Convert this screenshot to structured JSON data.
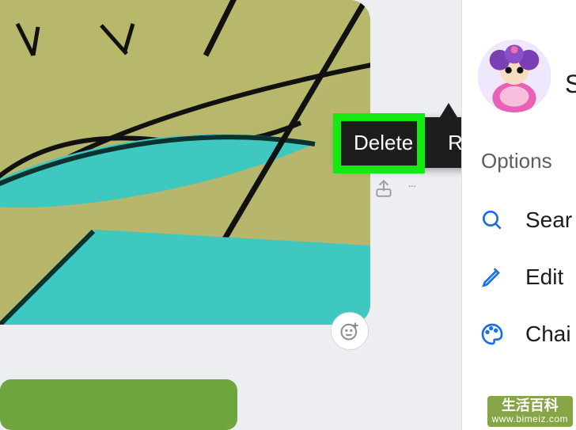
{
  "tooltip": {
    "delete": "Delete",
    "react": "React"
  },
  "panel": {
    "user_initial": "S",
    "options": "Options",
    "menu": [
      {
        "icon": "search-icon",
        "label": "Sear"
      },
      {
        "icon": "pencil-icon",
        "label": "Edit"
      },
      {
        "icon": "palette-icon",
        "label": "Chai"
      }
    ]
  },
  "watermark": {
    "line1": "生活百科",
    "url": "www.bimeiz.com"
  },
  "colors": {
    "highlight": "#12ea12",
    "accent": "#1a6fe8"
  }
}
